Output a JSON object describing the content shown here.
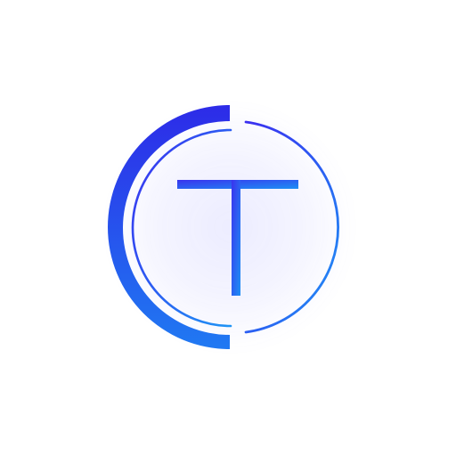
{
  "logo": {
    "icon": "t-monogram-logo-icon",
    "letter": "T",
    "colors": {
      "gradient_start": "#2f2fe8",
      "gradient_end": "#1e8ff5",
      "background": "#ffffff"
    }
  }
}
